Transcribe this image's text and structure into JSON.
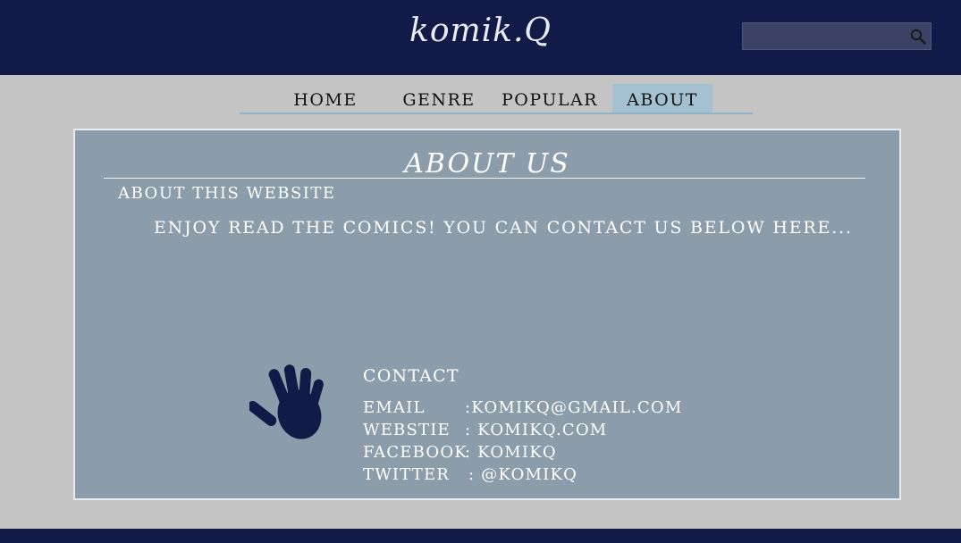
{
  "header": {
    "logo": "komik.Q",
    "search": {
      "placeholder": "",
      "icon": "search-icon"
    }
  },
  "nav": {
    "items": [
      {
        "label": "HOME"
      },
      {
        "label": "GENRE"
      },
      {
        "label": "POPULAR"
      },
      {
        "label": "ABOUT",
        "active": true
      }
    ]
  },
  "about": {
    "title": "ABOUT US",
    "subtitle": "ABOUT THIS WEBSITE",
    "intro": "ENJOY READ THE COMICS! YOU CAN CONTACT US BELOW HERE...",
    "hand_icon": "hand-icon",
    "contact": {
      "heading": "CONTACT",
      "rows": [
        {
          "label": "EMAIL",
          "value": ":KOMIKQ@GMAIL.COM"
        },
        {
          "label": "WEBSTIE",
          "value": ": KOMIKQ.COM"
        },
        {
          "label": "FACEBOOK",
          "value": ": KOMIKQ"
        },
        {
          "label": "TWITTER",
          "value": ": @KOMIKQ"
        }
      ]
    }
  },
  "colors": {
    "header": "#121b47",
    "page_bg": "#c4c4c4",
    "panel_bg": "#8b9daa",
    "nav_active": "#a4c1d2",
    "hand": "#121b47"
  }
}
